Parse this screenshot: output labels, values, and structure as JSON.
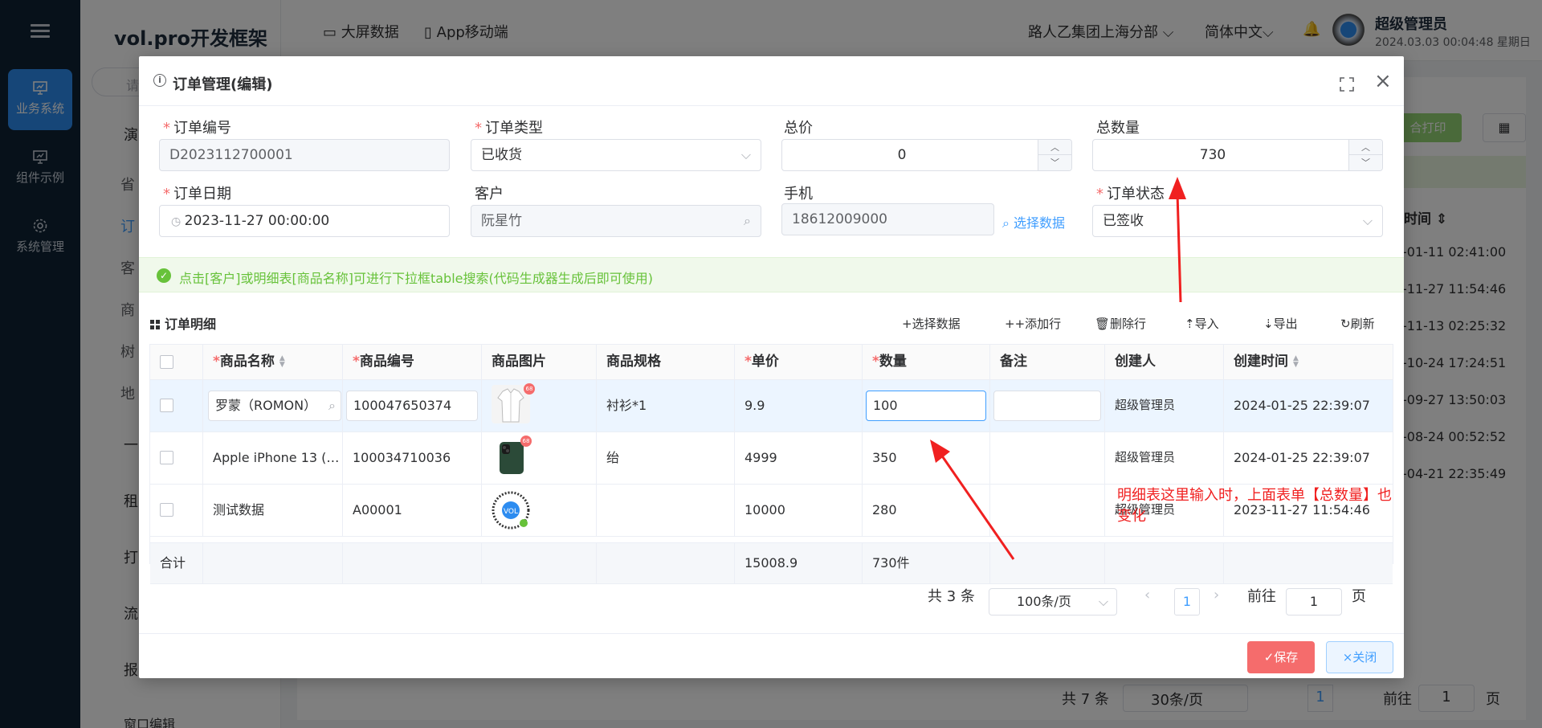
{
  "app": {
    "logo": "vol.pro开发框架",
    "leftbar": [
      "业务系统",
      "组件示例",
      "系统管理"
    ],
    "search_placeholder": "请",
    "sidebar_items": [
      "演",
      "一",
      "租",
      "打",
      "流",
      "报",
      "窗口编辑"
    ],
    "sidebar_subs": [
      "省",
      "订",
      "客",
      "商",
      "树",
      "地"
    ],
    "top_links": [
      "大屏数据",
      "App移动端"
    ],
    "org": "路人乙集团上海分部",
    "lang": "简体中文",
    "user_name": "超级管理员",
    "user_datetime": "2024.03.03 00:04:48 星期日",
    "bg_print": "合打印",
    "bg_col_header": "时间",
    "bg_rows": [
      "-01-11 02:41:00",
      "-11-27 11:54:46",
      "-11-13 02:25:32",
      "-10-24 17:24:51",
      "-09-27 13:50:03",
      "-08-24 00:52:52",
      "-04-21 22:35:49"
    ],
    "bg_pager_total": "共 7 条",
    "bg_pager_size": "30条/页",
    "bg_pager_page": "1",
    "bg_pager_goto": "前往",
    "bg_pager_goto_value": "1",
    "bg_pager_unit": "页"
  },
  "dialog": {
    "title": "订单管理(编辑)",
    "fields": {
      "order_no_label": "订单编号",
      "order_no": "D2023112700001",
      "order_type_label": "订单类型",
      "order_type": "已收货",
      "total_price_label": "总价",
      "total_price": "0",
      "total_qty_label": "总数量",
      "total_qty": "730",
      "order_date_label": "订单日期",
      "order_date": "2023-11-27 00:00:00",
      "customer_label": "客户",
      "customer": "阮星竹",
      "phone_label": "手机",
      "phone": "18612009000",
      "select_data": "选择数据",
      "status_label": "订单状态",
      "status": "已签收"
    },
    "alert": "点击[客户]或明细表[商品名称]可进行下拉框table搜索(代码生成器生成后即可使用)",
    "detail": {
      "title": "订单明细",
      "toolbar": [
        "+选择数据",
        "+添加行",
        "删除行",
        "导入",
        "导出",
        "刷新"
      ],
      "columns": [
        "商品名称",
        "商品编号",
        "商品图片",
        "商品规格",
        "单价",
        "数量",
        "备注",
        "创建人",
        "创建时间"
      ],
      "rows": [
        {
          "name": "罗蒙（ROMON）",
          "code": "100047650374",
          "spec": "衬衫*1",
          "price": "9.9",
          "qty": "100",
          "remark": "",
          "creator": "超级管理员",
          "time": "2024-01-25 22:39:07"
        },
        {
          "name": "Apple iPhone 13 (…",
          "code": "100034710036",
          "spec": "绐",
          "price": "4999",
          "qty": "350",
          "remark": "",
          "creator": "超级管理员",
          "time": "2024-01-25 22:39:07"
        },
        {
          "name": "测试数据",
          "code": "A00001",
          "spec": "",
          "price": "10000",
          "qty": "280",
          "remark": "",
          "creator": "超级管理员",
          "time": "2023-11-27 11:54:46"
        }
      ],
      "summary_label": "合计",
      "summary_price": "15008.9",
      "summary_qty": "730件"
    },
    "pager": {
      "total": "共 3 条",
      "size": "100条/页",
      "page": "1",
      "goto": "前往",
      "goto_value": "1",
      "unit": "页"
    },
    "save": "✓保存",
    "close": "×关闭"
  },
  "annotation": "明细表这里输入时，上面表单【总数量】也变化",
  "colors": {
    "primary": "#409eff",
    "danger": "#f56c6c",
    "success": "#67c23a",
    "nav_bg": "#0f2334"
  }
}
